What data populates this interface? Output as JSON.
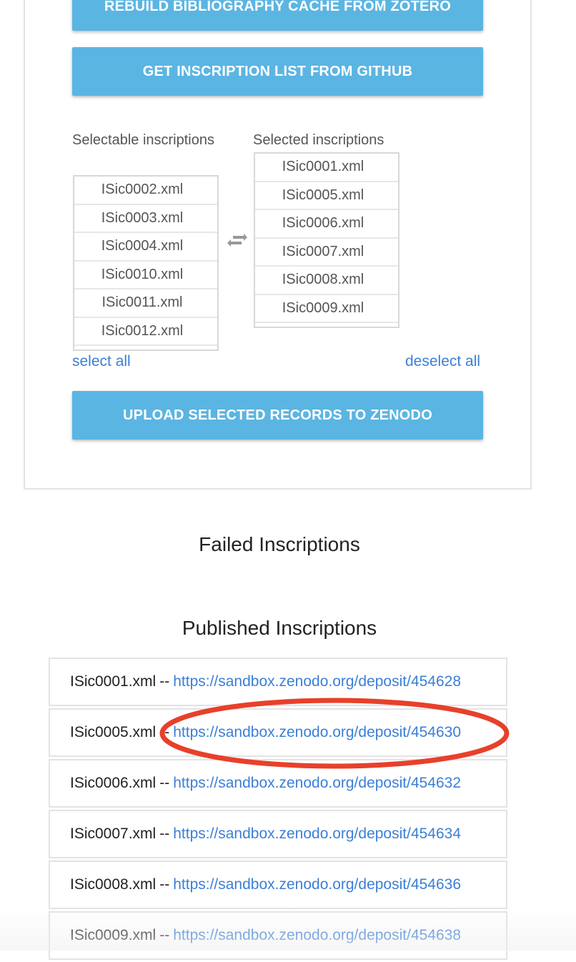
{
  "buttons": {
    "rebuild": "REBUILD BIBLIOGRAPHY CACHE FROM ZOTERO",
    "github": "GET INSCRIPTION LIST FROM GITHUB",
    "upload": "UPLOAD SELECTED RECORDS TO ZENODO"
  },
  "selector": {
    "selectable_label": "Selectable inscriptions",
    "selected_label": "Selected inscriptions",
    "selectable": [
      "ISic0002.xml",
      "ISic0003.xml",
      "ISic0004.xml",
      "ISic0010.xml",
      "ISic0011.xml",
      "ISic0012.xml"
    ],
    "selected": [
      "ISic0001.xml",
      "ISic0005.xml",
      "ISic0006.xml",
      "ISic0007.xml",
      "ISic0008.xml",
      "ISic0009.xml"
    ],
    "select_all": "select all",
    "deselect_all": "deselect all"
  },
  "failed": {
    "title": "Failed Inscriptions"
  },
  "published": {
    "title": "Published Inscriptions",
    "separator": "--",
    "items": [
      {
        "file": "ISic0001.xml",
        "url": "https://sandbox.zenodo.org/deposit/454628"
      },
      {
        "file": "ISic0005.xml",
        "url": "https://sandbox.zenodo.org/deposit/454630"
      },
      {
        "file": "ISic0006.xml",
        "url": "https://sandbox.zenodo.org/deposit/454632"
      },
      {
        "file": "ISic0007.xml",
        "url": "https://sandbox.zenodo.org/deposit/454634"
      },
      {
        "file": "ISic0008.xml",
        "url": "https://sandbox.zenodo.org/deposit/454636"
      },
      {
        "file": "ISic0009.xml",
        "url": "https://sandbox.zenodo.org/deposit/454638"
      }
    ]
  },
  "annotation": {
    "color": "#e8402a"
  },
  "theme": {
    "button_color": "#5bb5e2",
    "link_color": "#3b7fd6"
  },
  "icons": {
    "swap": "swap-arrows-icon"
  }
}
